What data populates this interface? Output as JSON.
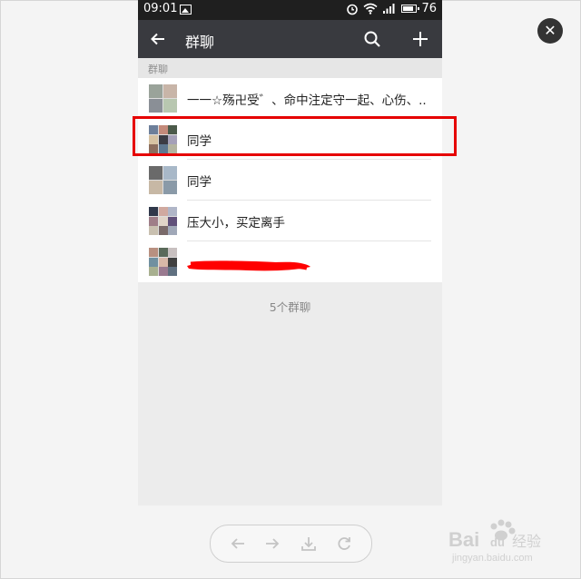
{
  "status_bar": {
    "time": "09:01",
    "battery": "76"
  },
  "header": {
    "title": "群聊"
  },
  "section": {
    "label": "群聊"
  },
  "groups": [
    {
      "name": "一一☆殇卍受゛、命中注定守一起、心伤、.."
    },
    {
      "name": "同学"
    },
    {
      "name": "同学"
    },
    {
      "name": "压大小，买定离手"
    },
    {
      "name": ""
    }
  ],
  "footer": {
    "count_text": "5个群聊"
  },
  "colors": {
    "title_bar": "#393a3f",
    "status_bar": "#1f1f1f",
    "highlight": "#e60000",
    "redaction": "#ff0000"
  },
  "watermark": {
    "text_main": "Bai",
    "text_paw": "du",
    "text_cn": "经验",
    "url": "jingyan.baidu.com"
  }
}
